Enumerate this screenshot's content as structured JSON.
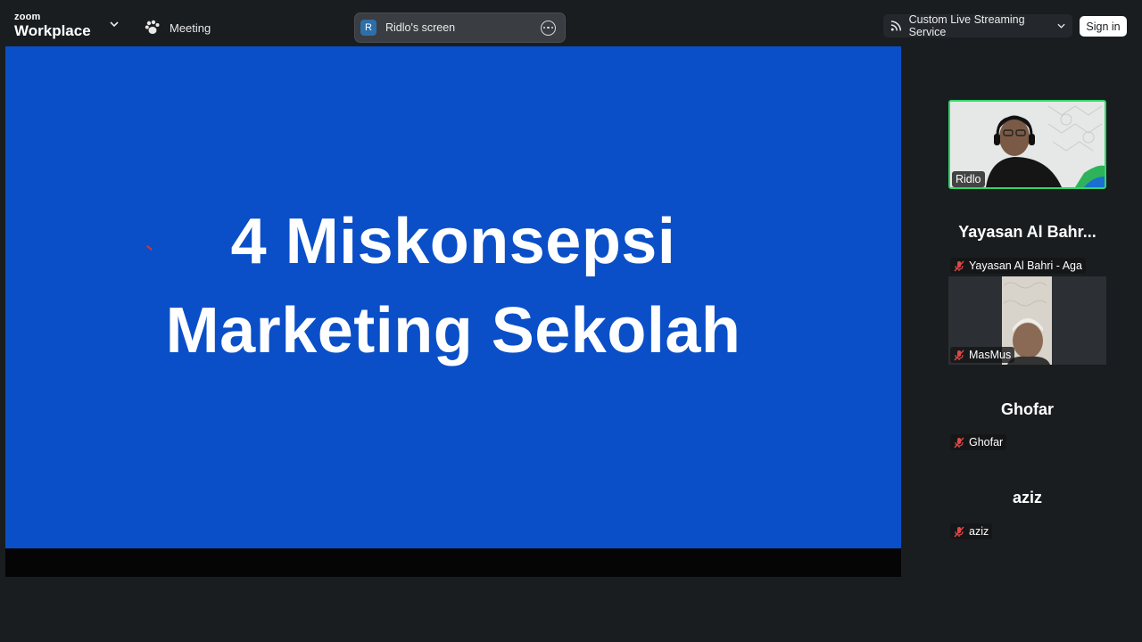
{
  "app": {
    "brand_small": "zoom",
    "brand_big": "Workplace",
    "meeting_label": "Meeting"
  },
  "share": {
    "avatar_letter": "R",
    "screen_label": "Ridlo's screen",
    "slide_line1": "4 Miskonsepsi",
    "slide_line2": "Marketing Sekolah",
    "slide_bg": "#0a4fc7"
  },
  "toolbar": {
    "stream_label": "Custom Live Streaming Service",
    "signin_label": "Sign in"
  },
  "participants": [
    {
      "name": "Ridlo",
      "video": true,
      "active_speaker": true
    },
    {
      "big_name": "Yayasan Al Bahr...",
      "name": "Yayasan Al Bahri - Aga",
      "muted": true
    },
    {
      "name": "MasMus",
      "video": true,
      "muted": true
    },
    {
      "big_name": "Ghofar",
      "name": "Ghofar",
      "muted": true
    },
    {
      "big_name": "aziz",
      "name": "aziz",
      "muted": true
    }
  ],
  "colors": {
    "background": "#1a1d20",
    "active_speaker_border": "#2fd66a",
    "mute_red": "#e04848"
  }
}
